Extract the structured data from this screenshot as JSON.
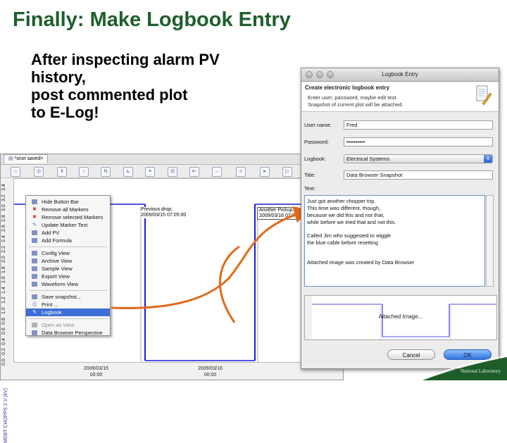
{
  "slide": {
    "title": "Finally: Make Logbook Entry",
    "bullet_lines": [
      "After inspecting alarm PV",
      "history,",
      "post commented plot",
      "to E-Log!"
    ]
  },
  "plot_window": {
    "tab_label": "*snot saved>",
    "y_axis_label": "MEBT CHOPPS 2 V (kV)",
    "y_ticks": [
      "0.0",
      "0.2",
      "0.4",
      "0.6",
      "0.8",
      "1.0",
      "1.2",
      "1.4",
      "1.6",
      "1.8",
      "2.0",
      "2.2",
      "2.4",
      "2.6",
      "2.8",
      "3.0",
      "3.2",
      "3.4"
    ],
    "x_labels": [
      {
        "date": "2009/03/15",
        "time": "00:00"
      },
      {
        "date": "2009/03/16",
        "time": "00:00"
      }
    ],
    "annotation_previous": {
      "line1": "Previous drop:",
      "line2": "2009/03/15 07:05:00"
    },
    "annotation_another": {
      "line1": "Another Pickup:",
      "line2": "2009/03/16 07:0"
    }
  },
  "context_menu": {
    "items": [
      {
        "label": "Hide Button Bar",
        "icon": "grid-icon",
        "color": "#5a6fb5"
      },
      {
        "label": "Remove all Markers",
        "icon": "red-x-icon",
        "color": "#d42b2b"
      },
      {
        "label": "Remove selected Markers",
        "icon": "red-x-icon",
        "color": "#d42b2b"
      },
      {
        "label": "Update Marker Text",
        "icon": "pencil-icon",
        "color": "#5a6fb5"
      },
      {
        "label": "Add PV",
        "icon": "add-pv-icon",
        "color": "#5a6fb5"
      },
      {
        "label": "Add Formula",
        "icon": "formula-icon",
        "color": "#5a6fb5"
      },
      {
        "label": "Config View",
        "icon": "config-icon",
        "color": "#5a6fb5"
      },
      {
        "label": "Archive View",
        "icon": "archive-icon",
        "color": "#5a6fb5"
      },
      {
        "label": "Sample View",
        "icon": "sample-icon",
        "color": "#5a6fb5"
      },
      {
        "label": "Export View",
        "icon": "export-icon",
        "color": "#5a6fb5"
      },
      {
        "label": "Waveform View",
        "icon": "waveform-icon",
        "color": "#5a6fb5"
      },
      {
        "label": "Save snapshot...",
        "icon": "camera-icon",
        "color": "#5a6fb5"
      },
      {
        "label": "Print ...",
        "icon": "printer-icon",
        "color": "#5a6fb5"
      },
      {
        "label": "Logbook",
        "icon": "logbook-pen-icon",
        "color": "#ffffff",
        "selected": true
      },
      {
        "label": "Open as View",
        "icon": "open-view-icon",
        "color": "#9a9a9a",
        "disabled": true
      },
      {
        "label": "Data Browser Perspective",
        "icon": "perspective-icon",
        "color": "#5a6fb5"
      }
    ]
  },
  "dialog": {
    "title": "Logbook Entry",
    "header_title": "Create electronic logbook entry",
    "header_desc_1": "Enter user, password, maybe edit text.",
    "header_desc_2": "Snapshot of current plot will be attached.",
    "user_label": "User name:",
    "user_value": "Fred",
    "password_label": "Password:",
    "password_value": "••••••••••",
    "logbook_label": "Logbook:",
    "logbook_value": "Electrical Systems",
    "title_label": "Title:",
    "title_value": "Data Browser Snapshot",
    "text_label": "Text:",
    "text_lines": [
      "Just got another chopper trip.",
      "This time was different, though,",
      "because we did this and not that,",
      "while before we tried that and not this.",
      "",
      "Called Jim who suggested to wiggle",
      "the blue cable before resetting",
      "",
      "",
      "Attached image was created by Data Browser"
    ],
    "snapshot_caption": "Attached Image...",
    "cancel_label": "Cancel",
    "ok_label": "OK"
  },
  "logo": {
    "text": "National Laboratory"
  }
}
